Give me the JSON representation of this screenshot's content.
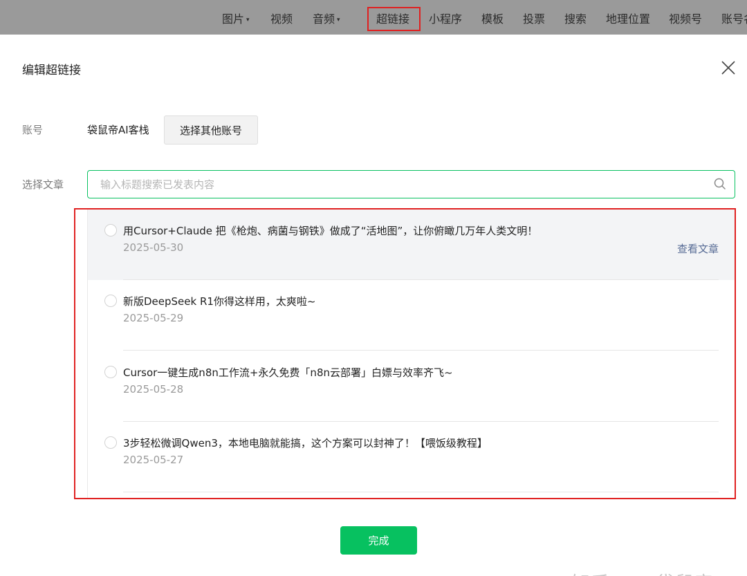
{
  "toolbar": {
    "items": [
      {
        "label": "图片",
        "caret": "▾"
      },
      {
        "label": "视频"
      },
      {
        "label": "音频",
        "caret": "▾"
      },
      {
        "label": "超链接"
      },
      {
        "label": "小程序"
      },
      {
        "label": "模板"
      },
      {
        "label": "投票"
      },
      {
        "label": "搜索"
      },
      {
        "label": "地理位置"
      },
      {
        "label": "视频号"
      },
      {
        "label": "账号名"
      }
    ]
  },
  "dialog": {
    "title": "编辑超链接",
    "close_icon": "close-icon",
    "account": {
      "label": "账号",
      "name": "袋鼠帝AI客栈",
      "switch_button": "选择其他账号"
    },
    "article": {
      "label": "选择文章",
      "search_placeholder": "输入标题搜索已发表内容",
      "search_icon": "search-icon"
    },
    "articles": [
      {
        "title": "用Cursor+Claude 把《枪炮、病菌与钢铁》做成了“活地图”，让你俯瞰几万年人类文明！",
        "date": "2025-05-30",
        "view_link": "查看文章"
      },
      {
        "title": "新版DeepSeek R1你得这样用，太爽啦~",
        "date": "2025-05-29"
      },
      {
        "title": "Cursor一键生成n8n工作流+永久免费「n8n云部署」白嫖与效率齐飞~",
        "date": "2025-05-28"
      },
      {
        "title": "3步轻松微调Qwen3，本地电脑就能搞，这个方案可以封神了！【喂饭级教程】",
        "date": "2025-05-27"
      }
    ],
    "done_button": "完成"
  },
  "watermark": "知乎 @AI袋鼠帝",
  "colors": {
    "accent": "#07c160",
    "link": "#576b95",
    "highlight_box": "#e02020",
    "toolbar_bg": "#9a9a9a"
  }
}
